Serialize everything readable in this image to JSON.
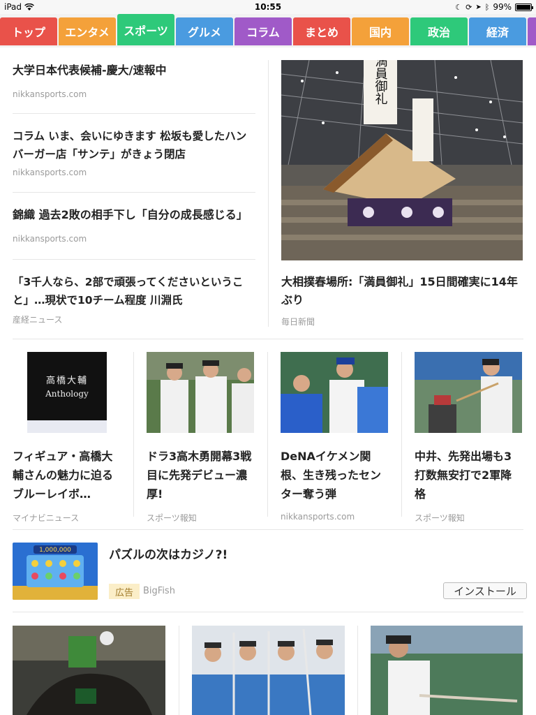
{
  "status_bar": {
    "device": "iPad",
    "time": "10:55",
    "battery": "99%",
    "battery_level": 0.99
  },
  "tabs": [
    {
      "label": "トップ",
      "color": "#e9524a"
    },
    {
      "label": "エンタメ",
      "color": "#f4a13a"
    },
    {
      "label": "スポーツ",
      "color": "#2ec97a",
      "active": true
    },
    {
      "label": "グルメ",
      "color": "#4a9be0"
    },
    {
      "label": "コラム",
      "color": "#a05ac8"
    },
    {
      "label": "まとめ",
      "color": "#e9524a"
    },
    {
      "label": "国内",
      "color": "#f4a13a"
    },
    {
      "label": "政治",
      "color": "#2ec97a"
    },
    {
      "label": "経済",
      "color": "#4a9be0"
    }
  ],
  "top_list": [
    {
      "title": "大学日本代表候補-慶大/速報中",
      "source": "nikkansports.com"
    },
    {
      "title": "コラム いま、会いにゆきます 松坂も愛したハンバーガー店「サンテ」がきょう閉店",
      "source": "nikkansports.com"
    },
    {
      "title": "錦織 過去2敗の相手下し「自分の成長感じる」",
      "source": "nikkansports.com"
    },
    {
      "title": "「3千人なら、2部で頑張ってくださいということ」…現状で10チーム程度 川淵氏",
      "source": "産経ニュース"
    }
  ],
  "feature": {
    "title": "大相撲春場所:「満員御礼」15日間確実に14年ぶり",
    "source": "毎日新聞",
    "banner_text": "満員御礼"
  },
  "cards": [
    {
      "title": "フィギュア・高橋大輔さんの魅力に迫るブルーレイボ…",
      "source": "マイナビニュース",
      "image_text_1": "高橋大輔",
      "image_text_2": "Anthology"
    },
    {
      "title": "ドラ3高木勇開幕3戦目に先発デビュー濃厚!",
      "source": "スポーツ報知"
    },
    {
      "title": "DeNAイケメン関根、生き残ったセンター奪う弾",
      "source": "nikkansports.com"
    },
    {
      "title": "中井、先発出場も3打数無安打で2軍降格",
      "source": "スポーツ報知"
    }
  ],
  "ad": {
    "title": "パズルの次はカジノ?!",
    "badge": "広告",
    "sponsor": "BigFish",
    "button": "インストール",
    "image_text": "1,000,000"
  }
}
